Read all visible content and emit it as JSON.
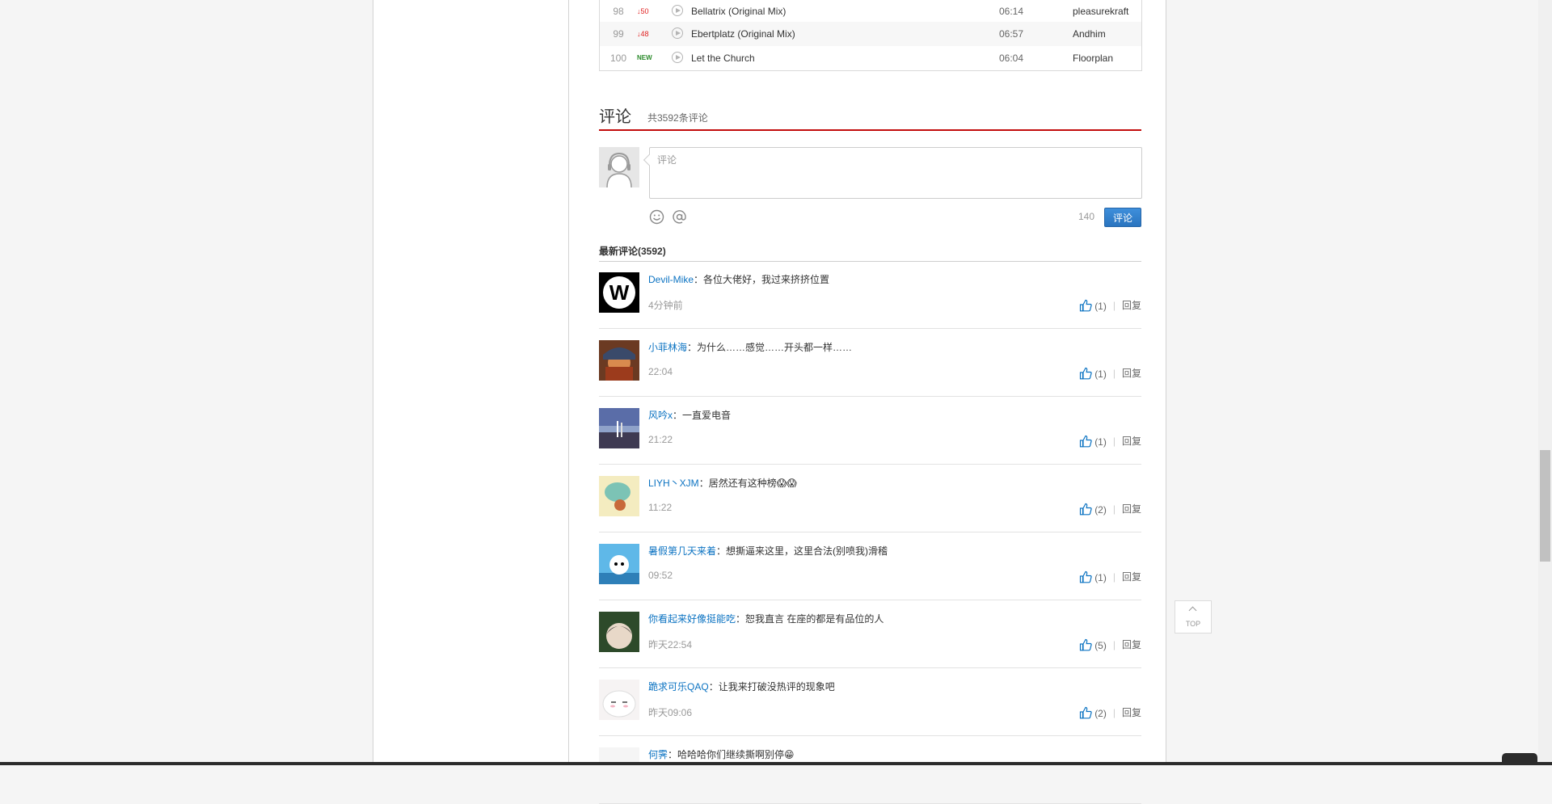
{
  "songs": [
    {
      "rank": "98",
      "trend": "↓50",
      "title": "Bellatrix (Original Mix)",
      "duration": "06:14",
      "artist": "pleasurekraft"
    },
    {
      "rank": "99",
      "trend": "↓48",
      "title": "Ebertplatz (Original Mix)",
      "duration": "06:57",
      "artist": "Andhim"
    },
    {
      "rank": "100",
      "trend": "NEW",
      "title": "Let the Church",
      "duration": "06:04",
      "artist": "Floorplan"
    }
  ],
  "comments_section": {
    "title": "评论",
    "total": "共3592条评论",
    "input_placeholder": "评论",
    "char_count": "140",
    "submit_label": "评论",
    "latest_title": "最新评论(3592)"
  },
  "comments": [
    {
      "user": "Devil-Mike",
      "text": "：各位大佬好，我过来挤挤位置",
      "time": "4分钟前",
      "likes": "(1)",
      "reply": "回复"
    },
    {
      "user": "小菲林海",
      "text": "：为什么……感觉……开头都一样……",
      "time": "22:04",
      "likes": "(1)",
      "reply": "回复"
    },
    {
      "user": "风吟x",
      "text": "：一直爱电音",
      "time": "21:22",
      "likes": "(1)",
      "reply": "回复"
    },
    {
      "user": "LIYH丶XJM",
      "text": "：居然还有这种榜😱😱",
      "time": "11:22",
      "likes": "(2)",
      "reply": "回复"
    },
    {
      "user": "暑假第几天来着",
      "text": "：想撕逼来这里，这里合法(别喷我)滑稽",
      "time": "09:52",
      "likes": "(1)",
      "reply": "回复"
    },
    {
      "user": "你看起来好像挺能吃",
      "text": "：恕我直言 在座的都是有品位的人",
      "time": "昨天22:54",
      "likes": "(5)",
      "reply": "回复"
    },
    {
      "user": "跪求可乐QAQ",
      "text": "：让我来打破没热评的现象吧",
      "time": "昨天09:06",
      "likes": "(2)",
      "reply": "回复"
    },
    {
      "user": "何霁",
      "text": "：哈哈哈你们继续撕啊别停😁",
      "time": "",
      "likes": "",
      "reply": ""
    }
  ],
  "top_button": "TOP",
  "icons": {
    "play": "play-icon",
    "emoji": "smile-icon",
    "at": "at-icon",
    "like": "thumbs-up-icon",
    "top": "chevron-up-icon"
  }
}
